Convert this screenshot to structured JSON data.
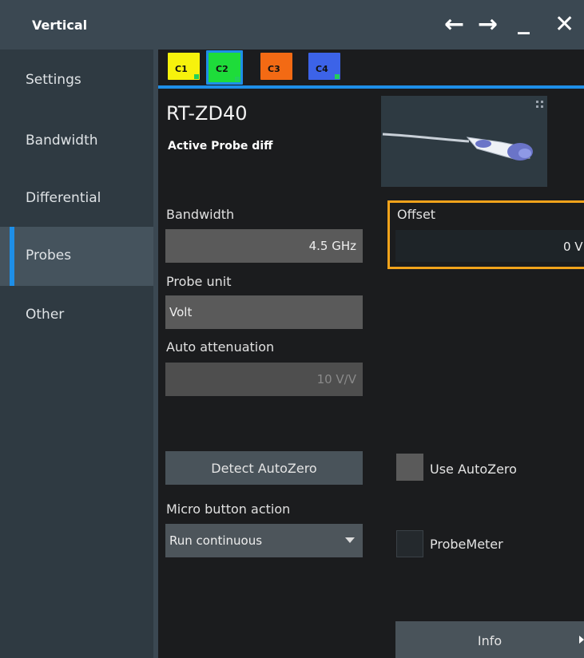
{
  "window": {
    "title": "Vertical",
    "controls": {
      "back": "←",
      "forward": "→",
      "minimize": "_",
      "close": "✕"
    }
  },
  "sidebar": {
    "items": [
      {
        "label": "Settings"
      },
      {
        "label": "Bandwidth"
      },
      {
        "label": "Differential"
      },
      {
        "label": "Probes",
        "active": true
      },
      {
        "label": "Other"
      }
    ]
  },
  "tabs": [
    {
      "label": "C1",
      "color": "#f7f20c"
    },
    {
      "label": "C2",
      "color": "#1edc3a",
      "selected": true
    },
    {
      "label": "C3",
      "color": "#f36a14"
    },
    {
      "label": "C4",
      "color": "#3c63e8"
    }
  ],
  "probe": {
    "name": "RT-ZD40",
    "type": "Active Probe diff",
    "image_icon": "probe-photo"
  },
  "fields": {
    "bandwidth": {
      "label": "Bandwidth",
      "value": "4.5 GHz"
    },
    "probe_unit": {
      "label": "Probe unit",
      "value": "Volt"
    },
    "auto_attenuation": {
      "label": "Auto attenuation",
      "value": "10 V/V"
    },
    "offset": {
      "label": "Offset",
      "value": "0 V"
    },
    "micro_button_action": {
      "label": "Micro button action",
      "value": "Run continuous"
    }
  },
  "buttons": {
    "detect_autozero": "Detect AutoZero",
    "info": "Info"
  },
  "checkboxes": {
    "use_autozero": {
      "label": "Use AutoZero",
      "checked": false
    },
    "probemeter": {
      "label": "ProbeMeter",
      "checked": false
    }
  },
  "colors": {
    "accent": "#1e8fe8",
    "focus": "#f2a31b"
  }
}
